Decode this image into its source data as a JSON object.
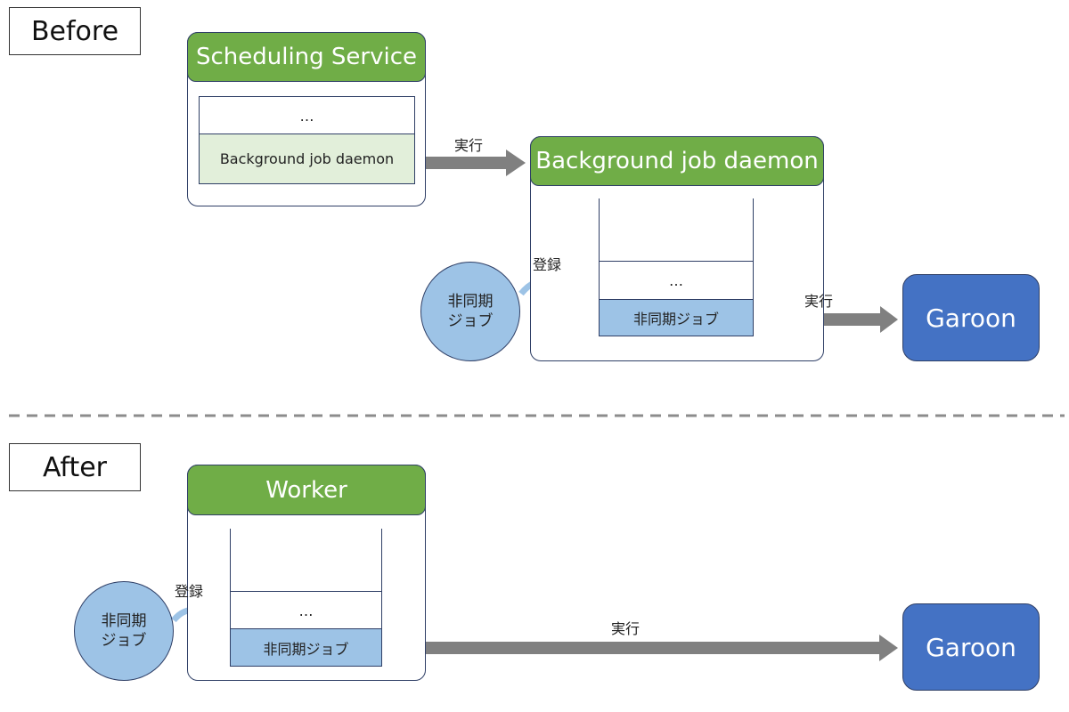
{
  "before": {
    "section_label": "Before",
    "scheduling_service": {
      "title": "Scheduling Service",
      "items": [
        "…",
        "Background job daemon"
      ]
    },
    "execute_label_1": "実行",
    "daemon": {
      "title": "Background job daemon",
      "queue_items": [
        "…",
        "非同期ジョブ"
      ]
    },
    "register_label": "登録",
    "async_job_circle": "非同期\nジョブ",
    "execute_label_2": "実行",
    "garoon": "Garoon"
  },
  "after": {
    "section_label": "After",
    "worker": {
      "title": "Worker",
      "queue_items": [
        "…",
        "非同期ジョブ"
      ]
    },
    "register_label": "登録",
    "async_job_circle": "非同期\nジョブ",
    "execute_label": "実行",
    "garoon": "Garoon"
  },
  "colors": {
    "header_green": "#70ad47",
    "light_green": "#e2efda",
    "light_blue": "#9dc3e6",
    "garoon_blue": "#4472c4",
    "arrow_gray": "#808080",
    "border_navy": "#2f3f66"
  }
}
